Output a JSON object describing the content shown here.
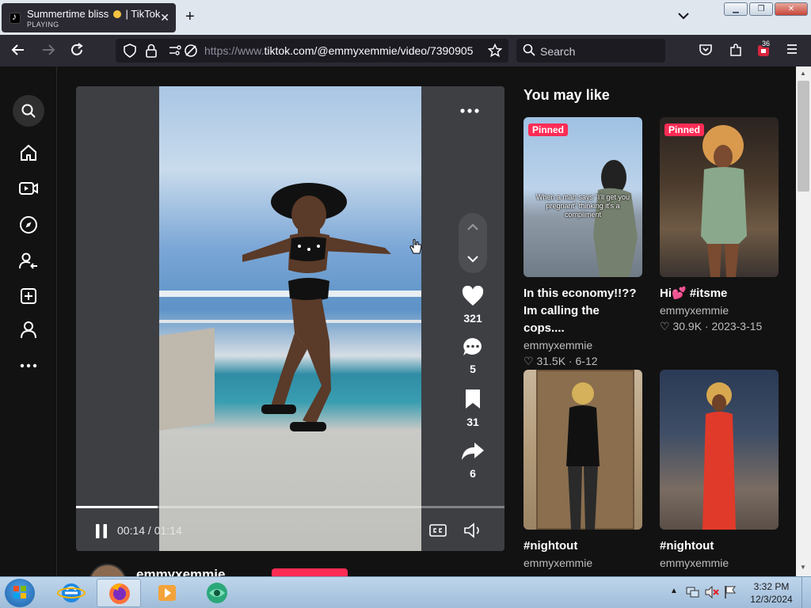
{
  "browser": {
    "tab_title_prefix": "Summertime bliss",
    "tab_title_suffix": "| TikTok",
    "tab_status": "PLAYING",
    "url_scheme": "https://www.",
    "url_host": "tiktok.com",
    "url_path": "/@emmyxemmie/video/7390905",
    "search_placeholder": "Search",
    "extensions_badge": "36"
  },
  "player": {
    "time": "00:14 / 01:14",
    "progress": 0.19,
    "likes": "321",
    "comments": "5",
    "saves": "31",
    "shares": "6",
    "author": "emmyxemmie"
  },
  "recommendations": {
    "title": "You may like",
    "items": [
      {
        "pinned": "Pinned",
        "overlay": "When a man says \"I'll get you pregnant\" thinking it's a compliment",
        "title": "In this economy!!?? Im calling the cops....",
        "author": "emmyxemmie",
        "likes": "31.5K",
        "date": "6-12"
      },
      {
        "pinned": "Pinned",
        "overlay": "",
        "title": "Hi💕 #itsme",
        "author": "emmyxemmie",
        "likes": "30.9K",
        "date": "2023-3-15"
      },
      {
        "pinned": "",
        "overlay": "",
        "title": "#nightout",
        "author": "emmyxemmie",
        "likes": "",
        "date": ""
      },
      {
        "pinned": "",
        "overlay": "",
        "title": "#nightout",
        "author": "emmyxemmie",
        "likes": "",
        "date": ""
      }
    ]
  },
  "taskbar": {
    "time": "3:32 PM",
    "date": "12/3/2024"
  }
}
